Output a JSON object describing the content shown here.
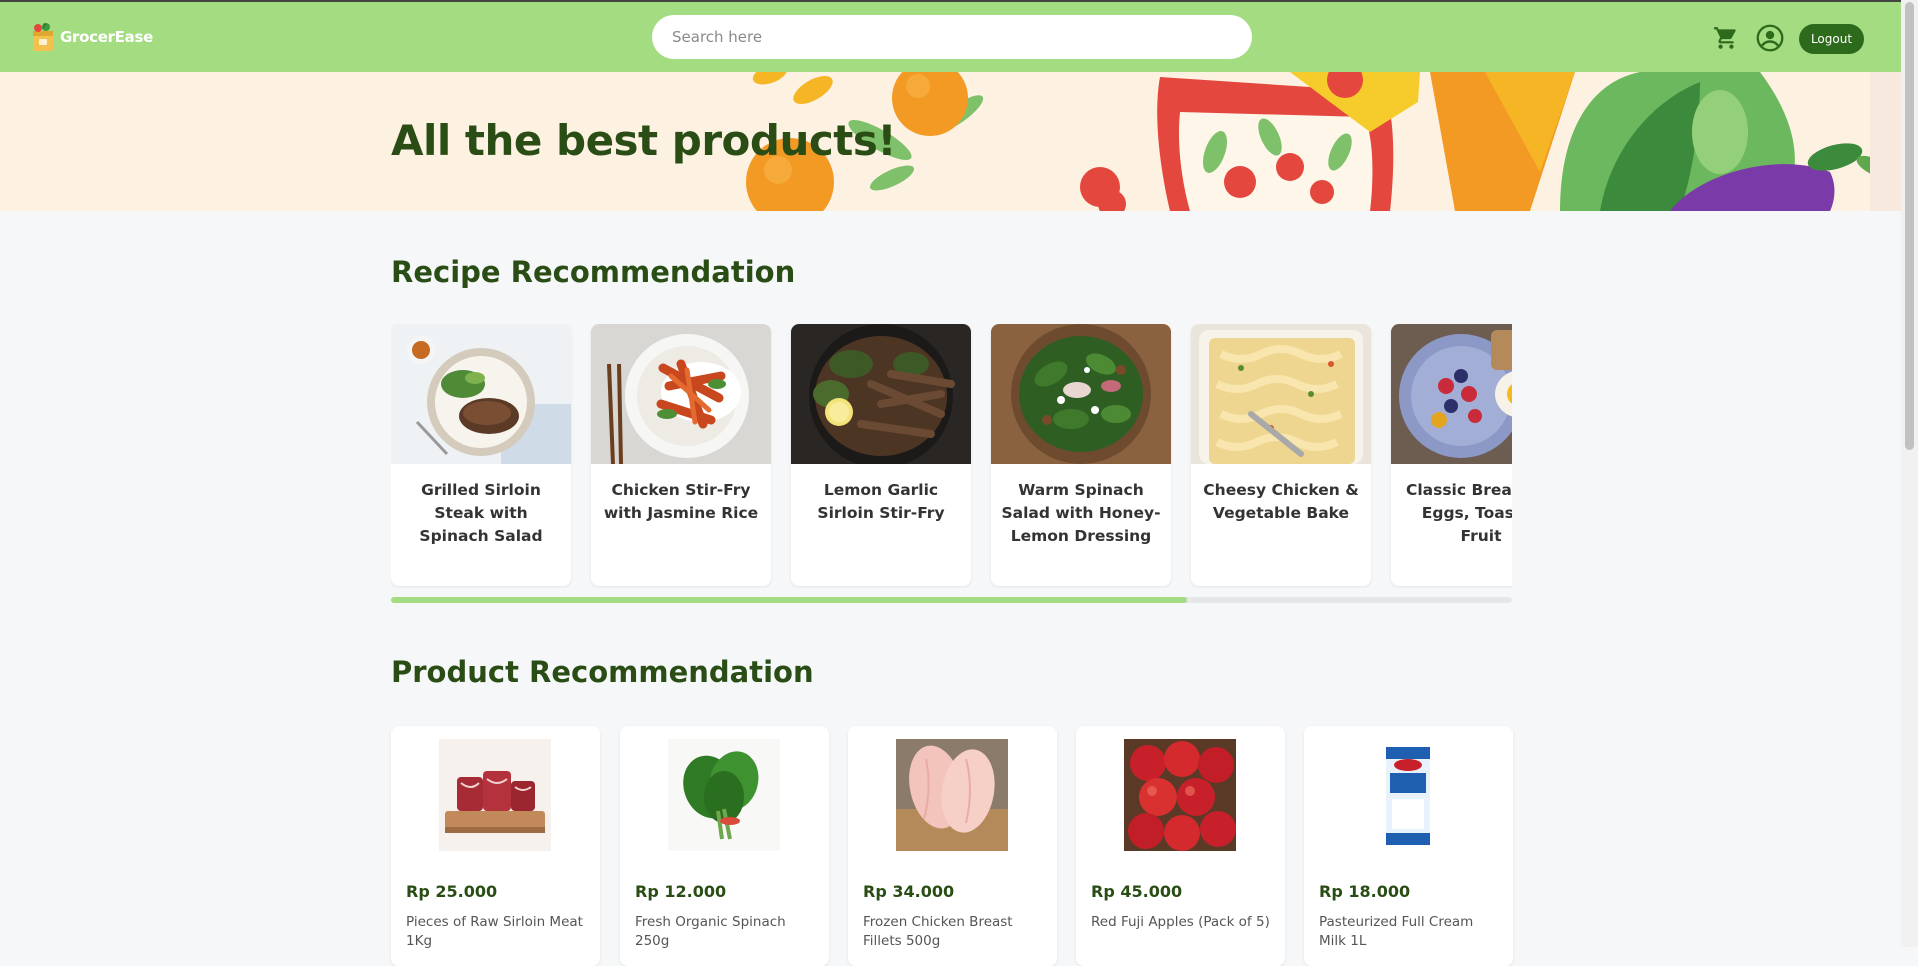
{
  "navbar": {
    "brand": "GrocerEase",
    "search_placeholder": "Search here",
    "logout_label": "Logout"
  },
  "hero": {
    "title": "All the best products!"
  },
  "recipes": {
    "title": "Recipe Recommendation",
    "items": [
      {
        "name": "Grilled Sirloin Steak with Spinach Salad"
      },
      {
        "name": "Chicken Stir-Fry with Jasmine Rice"
      },
      {
        "name": "Lemon Garlic Sirloin Stir-Fry"
      },
      {
        "name": "Warm Spinach Salad with Honey-Lemon Dressing"
      },
      {
        "name": "Cheesy Chicken & Vegetable Bake"
      },
      {
        "name": "Classic Breakfast Eggs, Toast & Fruit"
      }
    ],
    "scroll_progress": 0.71
  },
  "products": {
    "title": "Product Recommendation",
    "items": [
      {
        "price": "Rp 25.000",
        "name": "Pieces of Raw Sirloin Meat 1Kg"
      },
      {
        "price": "Rp 12.000",
        "name": "Fresh Organic Spinach 250g"
      },
      {
        "price": "Rp 34.000",
        "name": "Frozen Chicken Breast Fillets 500g"
      },
      {
        "price": "Rp 45.000",
        "name": "Red Fuji Apples (Pack of 5)"
      },
      {
        "price": "Rp 18.000",
        "name": "Pasteurized Full Cream Milk 1L"
      }
    ]
  },
  "colors": {
    "navbar": "#a3dc81",
    "accent_dark": "#2a4d15",
    "logout_button": "#2e6a1c",
    "hero_background": "#fdf2e2"
  },
  "icons": [
    "grocery-bag-icon",
    "cart-icon",
    "user-circle-icon"
  ]
}
